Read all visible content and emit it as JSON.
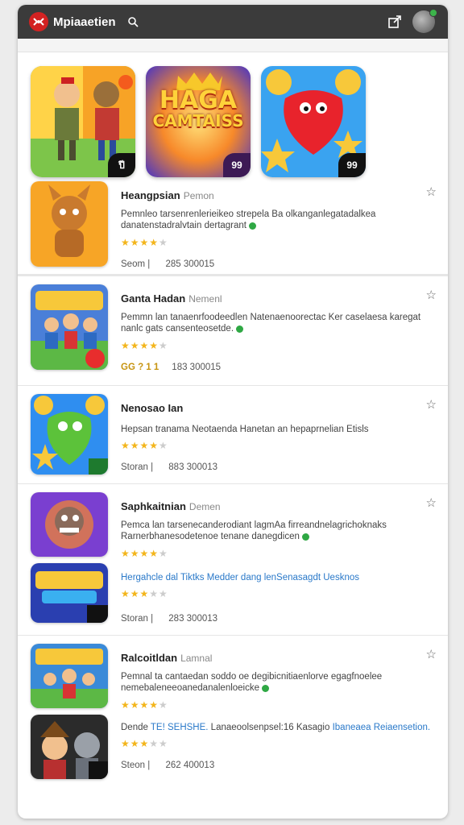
{
  "app": {
    "title": "Mpiaaetien"
  },
  "header": {
    "search_icon": "search-icon",
    "share_icon": "share-icon"
  },
  "featured": [
    {
      "id": "f1",
      "badge": "ปี"
    },
    {
      "id": "f2",
      "title_l1": "HAGA",
      "title_l2": "CAMTAISS",
      "badge": "99"
    },
    {
      "id": "f3",
      "badge": "99"
    }
  ],
  "items": [
    {
      "title": "Heangpsian",
      "sub": "Pemon",
      "desc": "Pemnleo tarsenrenlerieikeo strepela Ba olkanganlegatadalkea danatenstadralvtain dertagrant",
      "stars": "★★★★",
      "stars_off": "★",
      "meta_left": "Seom |",
      "meta_right": "285 300015"
    },
    {
      "title": "Ganta Hadan",
      "sub": "Nemenl",
      "desc": "Pemmn lan tanaenrfoodeedlen Natenaenoorectac Ker caselaesa karegat nanlc gats cansenteosetde.",
      "stars": "★★★★",
      "stars_off": "★",
      "meta_left": "GG ? 1 1",
      "meta_right": "183 300015"
    },
    {
      "title": "Nenosao Ian",
      "sub": "",
      "desc": "Hepsan tranama Neotaenda Hanetan an hepaprnelian Etisls",
      "stars": "★★★★",
      "stars_off": "★",
      "meta_left": "Storan |",
      "meta_right": "883 300013"
    },
    {
      "title": "Saphkaitnian",
      "sub": "Demen",
      "desc": "Pemca lan tarsenecanderodiant lagmAa firreandnelagrichoknaks Rarnerbhanesodetenoe tenane danegdicen",
      "extra": "Hergahcle dal Tiktks Medder dang lenSenasagdt",
      "extra_link": "Uesknos",
      "stars": "★★★★",
      "stars_off": "★",
      "stars2": "★★★",
      "stars2_off": "★★",
      "meta_left": "Storan |",
      "meta_right": "283 300013"
    },
    {
      "title": "Ralcoitldan",
      "sub": "Lamnal",
      "desc": "Pemnal ta cantaedan soddo oe degibicnitiaenlorve egagfnoelee nemebaleneeoanedanalenloeicke",
      "extra_pre": "Dende",
      "extra_link": "TE! SEHSHE.",
      "extra": "Lanaeoolsenpsel:16 Kasagio",
      "extra_link2": "Ibaneaea Reiaensetion.",
      "stars": "★★★★",
      "stars_off": "★",
      "stars2": "★★★",
      "stars2_off": "★★",
      "meta_left": "Steon |",
      "meta_right": "262 400013"
    }
  ]
}
